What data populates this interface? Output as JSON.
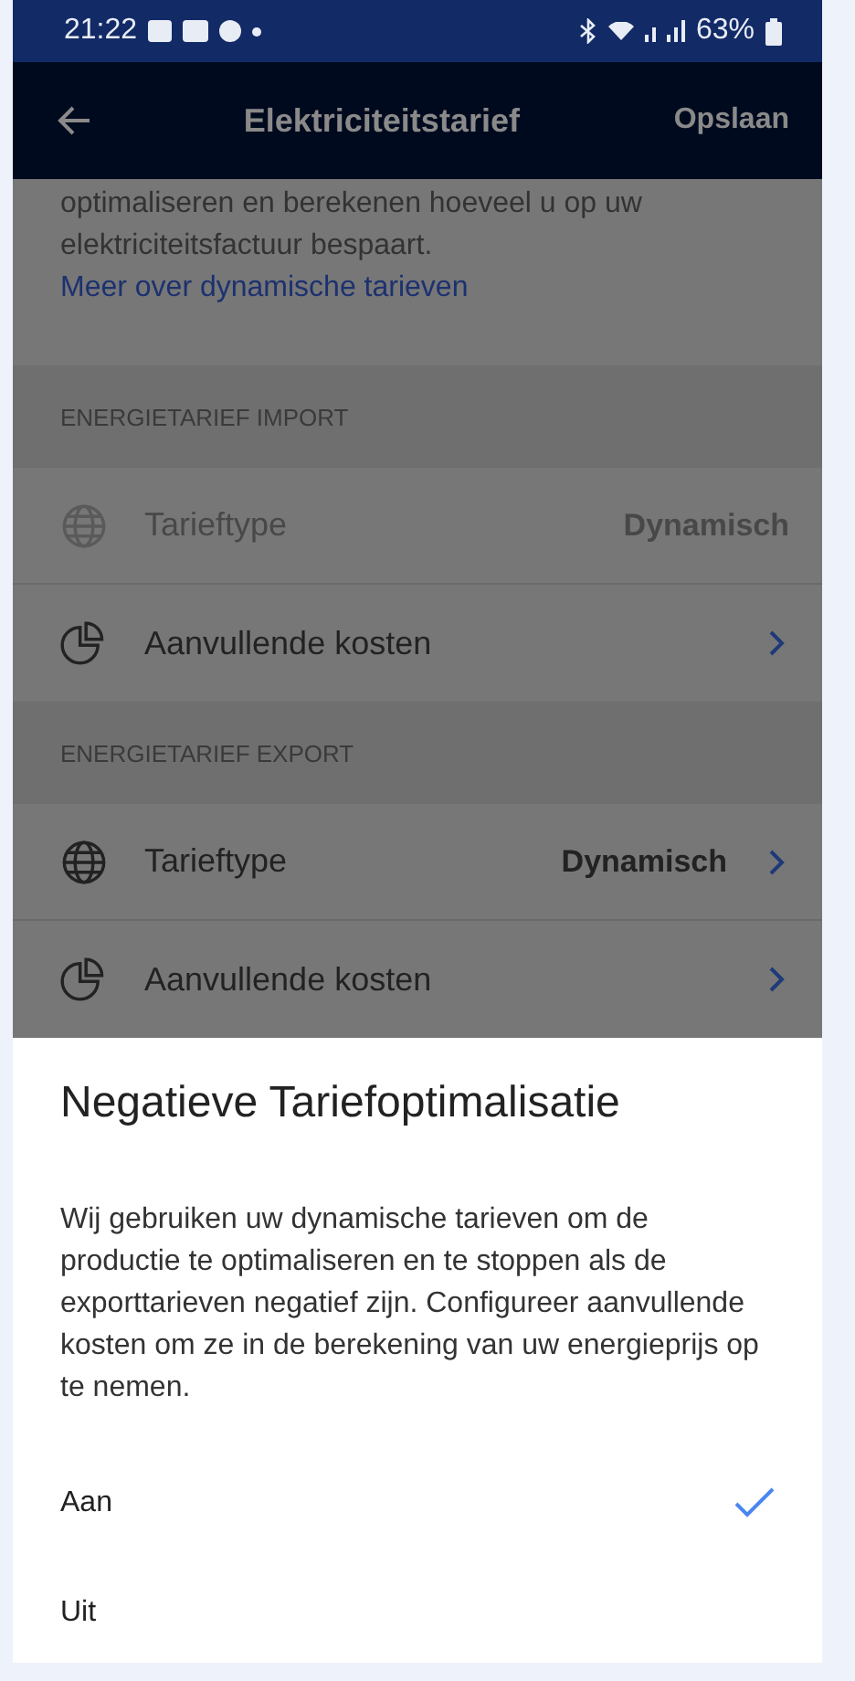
{
  "status_bar": {
    "time": "21:22",
    "battery": "63%"
  },
  "app_bar": {
    "title": "Elektriciteitstarief",
    "action": "Opslaan"
  },
  "intro": {
    "text": "optimaliseren en berekenen hoeveel u op uw elektriciteitsfactuur bespaart.",
    "link": "Meer over dynamische tarieven"
  },
  "sections": [
    {
      "header": "ENERGIETARIEF IMPORT",
      "rows": [
        {
          "kind": "type",
          "label": "Tarieftype",
          "value": "Dynamisch",
          "disabled": true
        },
        {
          "kind": "costs",
          "label": "Aanvullende kosten",
          "disabled": false
        }
      ]
    },
    {
      "header": "ENERGIETARIEF EXPORT",
      "rows": [
        {
          "kind": "type",
          "label": "Tarieftype",
          "value": "Dynamisch",
          "disabled": false
        },
        {
          "kind": "costs",
          "label": "Aanvullende kosten",
          "disabled": false
        }
      ]
    }
  ],
  "sheet": {
    "title": "Negatieve Tariefoptimalisatie",
    "text": "Wij gebruiken uw dynamische tarieven om de productie te optimaliseren en te stoppen als de exporttarieven negatief zijn. Configureer aanvullende kosten om ze in de berekening van uw energieprijs op te nemen.",
    "options": [
      {
        "label": "Aan",
        "selected": true
      },
      {
        "label": "Uit",
        "selected": false
      }
    ]
  }
}
